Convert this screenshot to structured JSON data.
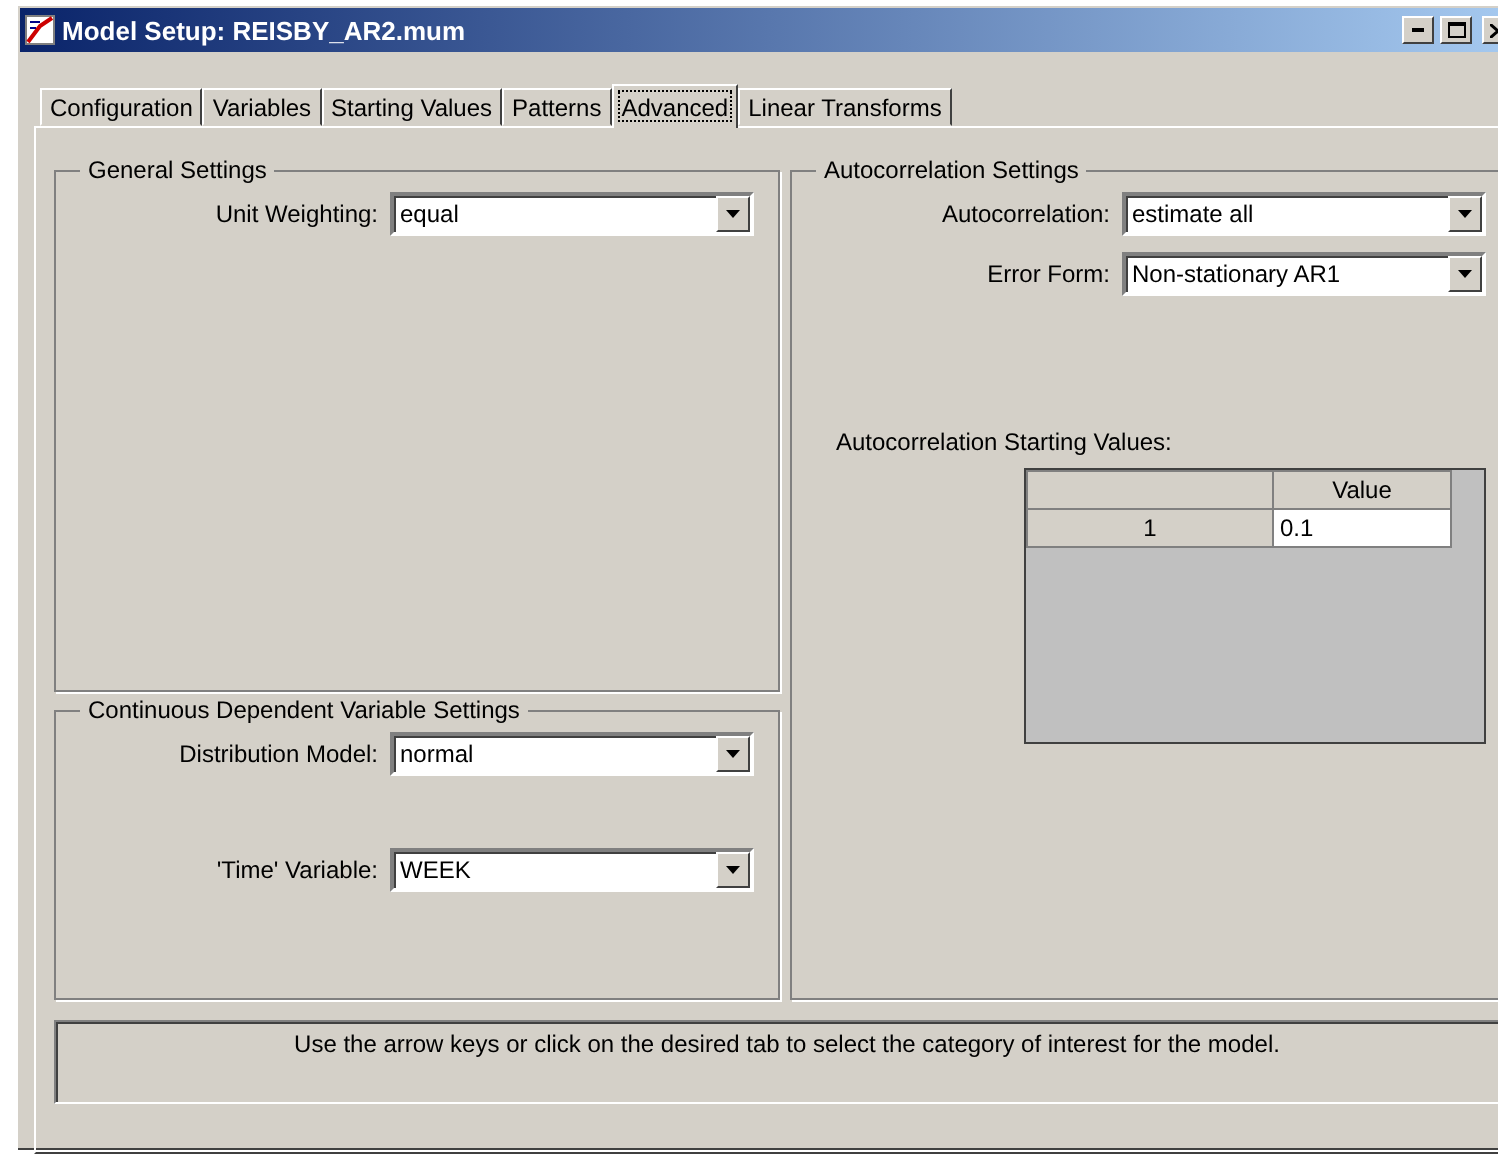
{
  "window": {
    "title": "Model Setup: REISBY_AR2.mum"
  },
  "tabs": [
    {
      "label": "Configuration",
      "selected": false
    },
    {
      "label": "Variables",
      "selected": false
    },
    {
      "label": "Starting Values",
      "selected": false
    },
    {
      "label": "Patterns",
      "selected": false
    },
    {
      "label": "Advanced",
      "selected": true
    },
    {
      "label": "Linear Transforms",
      "selected": false
    }
  ],
  "general_settings": {
    "title": "General Settings",
    "fields": [
      {
        "label": "Unit Weighting:",
        "value": "equal"
      }
    ]
  },
  "continuous_settings": {
    "title": "Continuous Dependent Variable Settings",
    "fields": [
      {
        "label": "Distribution Model:",
        "value": "normal"
      },
      {
        "label": "'Time' Variable:",
        "value": "WEEK"
      }
    ]
  },
  "autocorrelation_settings": {
    "title": "Autocorrelation Settings",
    "fields": [
      {
        "label": "Autocorrelation:",
        "value": "estimate all"
      },
      {
        "label": "Error Form:",
        "value": "Non-stationary AR1"
      }
    ],
    "table": {
      "title": "Autocorrelation Starting Values:",
      "columns": [
        "Value"
      ],
      "rows": [
        {
          "header": "1",
          "cells": [
            "0.1"
          ]
        }
      ]
    }
  },
  "status_bar": "Use the arrow keys or click on the desired tab to select the category of interest for the model."
}
